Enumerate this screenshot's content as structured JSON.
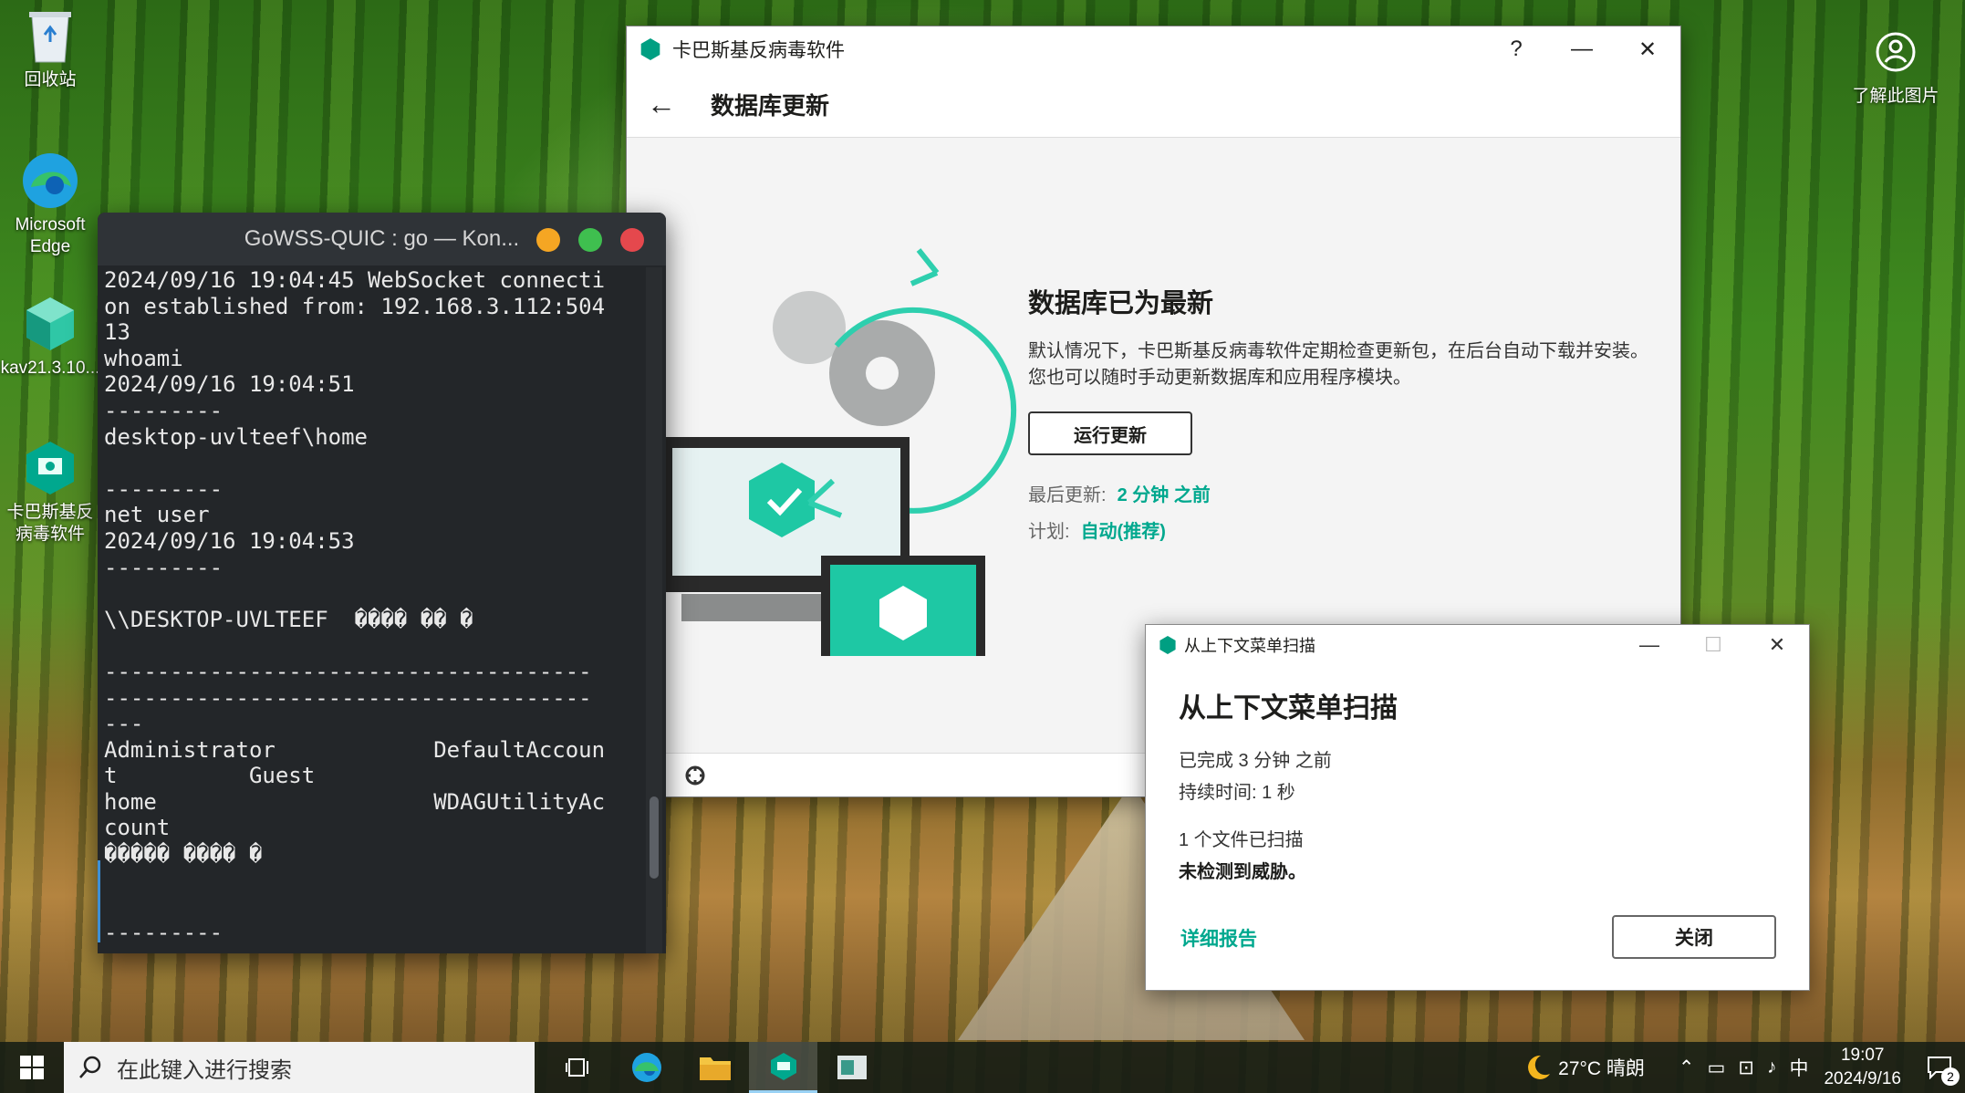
{
  "desktop": {
    "icons": [
      {
        "label": "回收站"
      },
      {
        "label": "Microsoft Edge"
      },
      {
        "label": "kav21.3.10..."
      },
      {
        "label": "卡巴斯基反病毒软件"
      }
    ],
    "learn_picture": "了解此图片"
  },
  "kav": {
    "title": "卡巴斯基反病毒软件",
    "help": "?",
    "minimize": "—",
    "close": "✕",
    "back": "←",
    "page_title": "数据库更新",
    "status_title": "数据库已为最新",
    "description": "默认情况下，卡巴斯基反病毒软件定期检查更新包，在后台自动下载并安装。您也可以随时手动更新数据库和应用程序模块。",
    "run_update": "运行更新",
    "last_update_label": "最后更新:",
    "last_update_value": "2 分钟 之前",
    "schedule_label": "计划:",
    "schedule_value": "自动(推荐)",
    "accent": "#00a88e"
  },
  "terminal": {
    "title": "GoWSS-QUIC : go — Kon...",
    "lines": "2024/09/16 19:04:45 WebSocket connecti\non established from: 192.168.3.112:504\n13\nwhoami\n2024/09/16 19:04:51\n---------\ndesktop-uvlteef\\home\n\n---------\nnet user\n2024/09/16 19:04:53\n---------\n\n\\\\DESKTOP-UVLTEEF  ���� �� �\n\n-------------------------------------\n-------------------------------------\n---\nAdministrator            DefaultAccoun\nt          Guest\nhome                     WDAGUtilityAc\ncount\n����� ���� �\n\n\n---------"
  },
  "scan": {
    "title": "从上下文菜单扫描",
    "heading": "从上下文菜单扫描",
    "completed": "已完成 3 分钟 之前",
    "duration": "持续时间: 1 秒",
    "files": "1 个文件已扫描",
    "result": "未检测到威胁。",
    "report_link": "详细报告",
    "close_button": "关闭",
    "minimize": "—",
    "maximize": "☐",
    "close": "✕"
  },
  "taskbar": {
    "search_placeholder": "在此键入进行搜索",
    "weather": "27°C  晴朗",
    "ime": "中",
    "time": "19:07",
    "date": "2024/9/16",
    "notifications": "2"
  }
}
